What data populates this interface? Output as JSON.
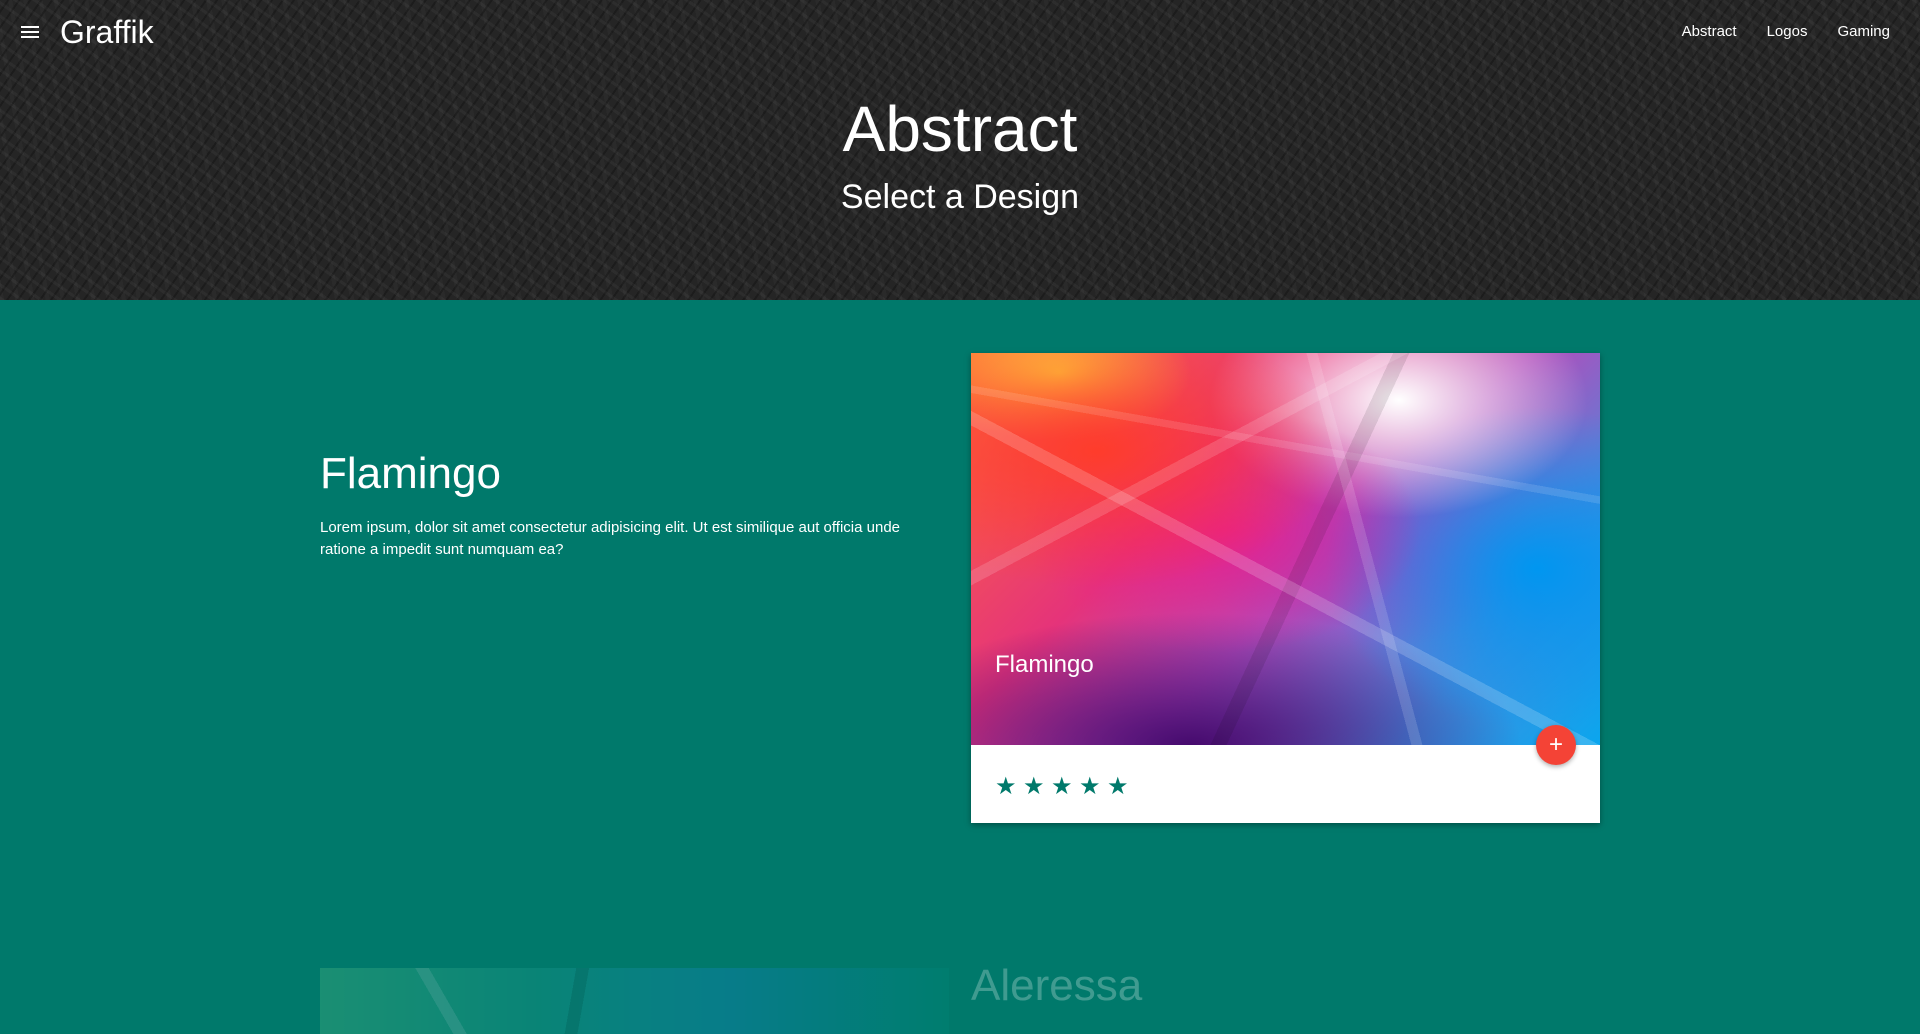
{
  "navbar": {
    "brand": "Graffik",
    "menu_icon": "menu-icon",
    "links": [
      {
        "label": "Abstract"
      },
      {
        "label": "Logos"
      },
      {
        "label": "Gaming"
      }
    ]
  },
  "hero": {
    "title": "Abstract",
    "subtitle": "Select a Design"
  },
  "design": {
    "title": "Flamingo",
    "description": "Lorem ipsum, dolor sit amet consectetur adipisicing elit. Ut est similique aut officia unde ratione a impedit sunt numquam ea?",
    "card": {
      "image_title": "Flamingo",
      "fab_label": "+",
      "fab_icon": "plus-icon",
      "rating": 5,
      "rating_max": 5,
      "star_glyph": "★"
    }
  },
  "next_design": {
    "title": "Aleressa"
  },
  "colors": {
    "primary": "#00796b",
    "accent": "#f44336",
    "header_bg": "#252525"
  }
}
